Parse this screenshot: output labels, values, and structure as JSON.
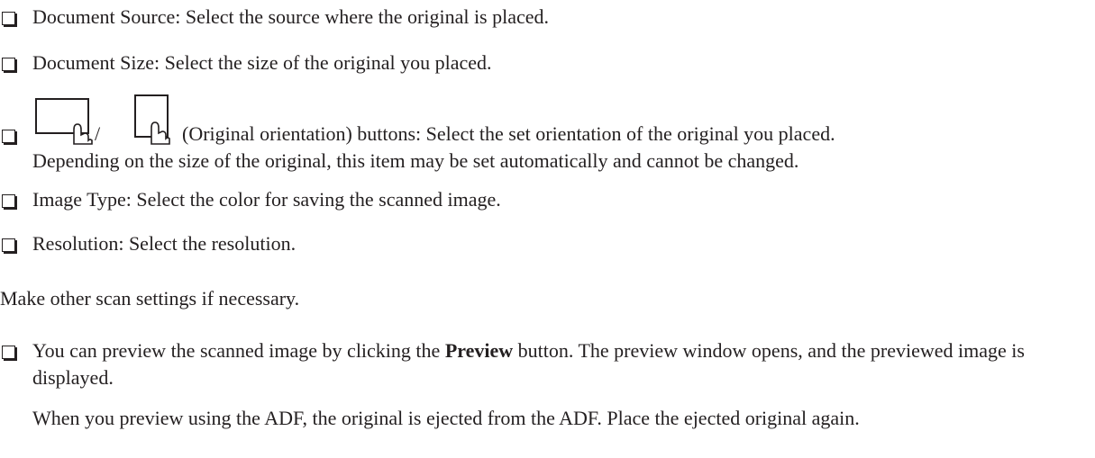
{
  "items": [
    {
      "text": "Document Source: Select the source where the original is placed."
    },
    {
      "text": "Document Size: Select the size of the original you placed."
    },
    {
      "text": "(Original orientation) buttons: Select the set orientation of the original you placed.",
      "text2": "Depending on the size of the original, this item may be set automatically and cannot be changed.",
      "separator": "/"
    },
    {
      "text": "Image Type: Select the color for saving the scanned image."
    },
    {
      "text": "Resolution: Select the resolution."
    }
  ],
  "note": "Make other scan settings if necessary.",
  "preview_item": {
    "before": "You can preview the scanned image by clicking the ",
    "bold": "Preview",
    "after": " button. The preview window opens, and the previewed image is displayed.",
    "extra": "When you preview using the ADF, the original is ejected from the ADF. Place the ejected original again."
  },
  "icons": [
    "landscape-orientation-icon",
    "portrait-orientation-icon"
  ]
}
